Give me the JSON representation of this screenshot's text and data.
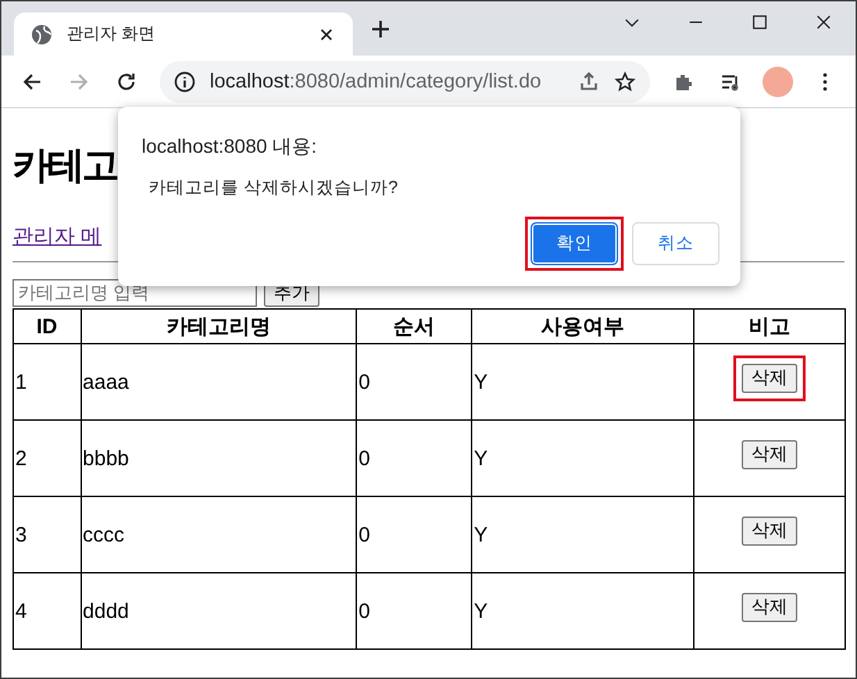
{
  "browser": {
    "tab_title": "관리자 화면",
    "url_host": "localhost",
    "url_path": ":8080/admin/category/list.do"
  },
  "page": {
    "heading": "카테고",
    "link": "관리자 메",
    "input": {
      "placeholder": "카테고리명 입력"
    },
    "add_button": "추가"
  },
  "table": {
    "columns": [
      "ID",
      "카테고리명",
      "순서",
      "사용여부",
      "비고"
    ],
    "rows": [
      {
        "id": "1",
        "name": "aaaa",
        "order": "0",
        "use": "Y",
        "action": "삭제",
        "highlighted": true
      },
      {
        "id": "2",
        "name": "bbbb",
        "order": "0",
        "use": "Y",
        "action": "삭제",
        "highlighted": false
      },
      {
        "id": "3",
        "name": "cccc",
        "order": "0",
        "use": "Y",
        "action": "삭제",
        "highlighted": false
      },
      {
        "id": "4",
        "name": "dddd",
        "order": "0",
        "use": "Y",
        "action": "삭제",
        "highlighted": false
      }
    ]
  },
  "dialog": {
    "title": "localhost:8080 내용:",
    "message": "카테고리를 삭제하시겠습니까?",
    "buttons": [
      {
        "label": "확인",
        "kind": "primary",
        "highlighted": true
      },
      {
        "label": "취소",
        "kind": "secondary",
        "highlighted": false
      }
    ]
  }
}
